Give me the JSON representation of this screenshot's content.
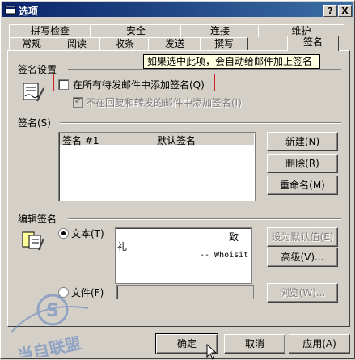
{
  "window": {
    "title": "选项",
    "help_btn": "?",
    "close_btn": "X"
  },
  "tabs_back": [
    "拼写检查",
    "安全",
    "连接",
    "维护"
  ],
  "tabs_front": [
    "常规",
    "阅读",
    "收条",
    "发送",
    "撰写",
    "签名"
  ],
  "tooltip": "如果选中此项，会自动给邮件加上签名",
  "settings": {
    "title": "签名设置",
    "add_all": "在所有待发邮件中添加签名(Q)",
    "no_reply": "不在回复和转发的邮件中添加签名(I)"
  },
  "signatures": {
    "title": "签名(S)",
    "rows": [
      {
        "name": "签名 #1",
        "status": "默认签名"
      }
    ],
    "new_btn": "新建(N)",
    "delete_btn": "删除(R)",
    "rename_btn": "重命名(M)"
  },
  "edit": {
    "title": "编辑签名",
    "text_radio": "文本(T)",
    "file_radio": "文件(F)",
    "text_lines": [
      "致",
      "礼",
      "-- Whoisit"
    ],
    "default_btn": "设为默认值(E)",
    "advanced_btn": "高级(V)...",
    "browse_btn": "浏览(W)..."
  },
  "footer": {
    "ok": "确定",
    "cancel": "取消",
    "apply": "应用(A)"
  },
  "watermark_text": "当自联盟"
}
